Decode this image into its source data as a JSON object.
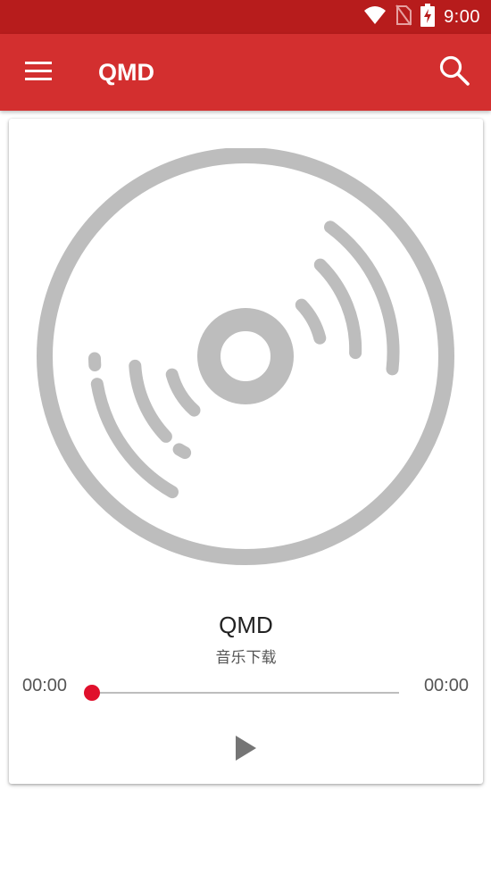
{
  "status_bar": {
    "time": "9:00",
    "icons": [
      "wifi-icon",
      "no-sim-icon",
      "battery-charging-icon"
    ],
    "color": "#b71c1c"
  },
  "app_bar": {
    "title": "QMD",
    "menu_icon": "menu-icon",
    "search_icon": "search-icon",
    "color": "#d32f2f"
  },
  "player": {
    "artwork_icon": "disc-icon",
    "track_title": "QMD",
    "track_subtitle": "音乐下载",
    "elapsed_time": "00:00",
    "total_time": "00:00",
    "progress": 0,
    "play_icon": "play-icon",
    "accent_color": "#e0102c"
  }
}
